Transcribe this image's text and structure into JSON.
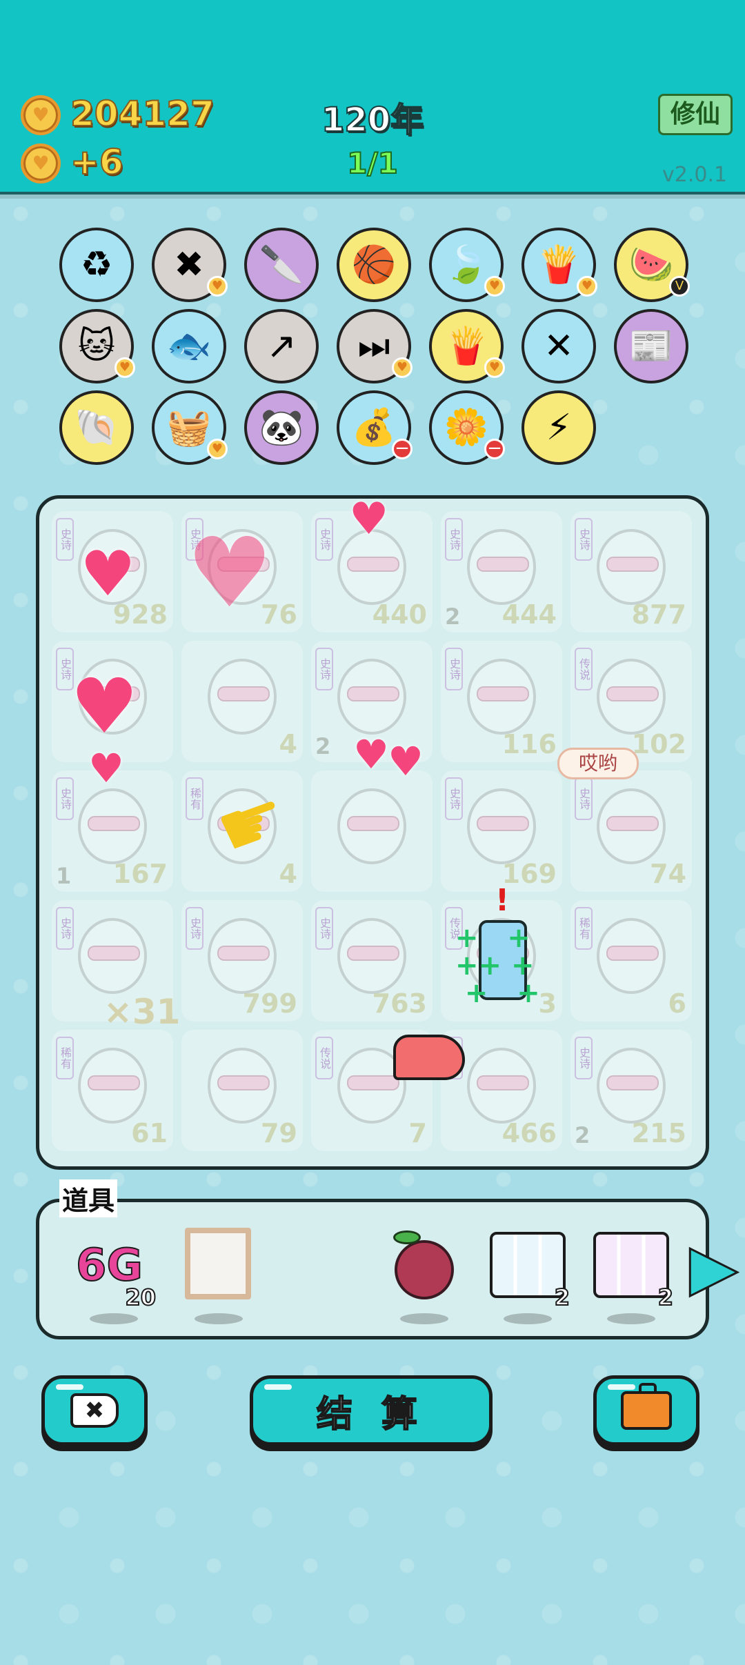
{
  "header": {
    "coins": "204127",
    "income": "+6",
    "year": "120年",
    "progress": "1/1",
    "mode_button": "修仙",
    "version": "v2.0.1"
  },
  "skills": [
    {
      "icon": "trash-recycle-icon",
      "bg": "#a8e3f4",
      "glyph": "♻",
      "badge": ""
    },
    {
      "icon": "delete-tag-icon",
      "bg": "#d8d3ce",
      "glyph": "✖",
      "badge": "heart"
    },
    {
      "icon": "cleaver-icon",
      "bg": "#c9a3df",
      "glyph": "🔪",
      "badge": ""
    },
    {
      "icon": "basketballs-icon",
      "bg": "#f7ea7a",
      "glyph": "🏀",
      "badge": ""
    },
    {
      "icon": "leaf-icon",
      "bg": "#a8e3f4",
      "glyph": "🍃",
      "badge": "heart"
    },
    {
      "icon": "fries-icon",
      "bg": "#a8e3f4",
      "glyph": "🍟",
      "badge": "heart"
    },
    {
      "icon": "fruit-bowl-icon",
      "bg": "#f7ea7a",
      "glyph": "🍉",
      "badge": "v"
    },
    {
      "icon": "cat-sunglasses-icon",
      "bg": "#d8d3ce",
      "glyph": "🐱",
      "badge": "heart"
    },
    {
      "icon": "fish-bowl-icon",
      "bg": "#a8e3f4",
      "glyph": "🐟",
      "badge": ""
    },
    {
      "icon": "arrow-up-right-icon",
      "bg": "#d8d3ce",
      "glyph": "↗",
      "badge": ""
    },
    {
      "icon": "skip-icon",
      "bg": "#d8d3ce",
      "glyph": "⏭",
      "badge": "heart"
    },
    {
      "icon": "fries-icon",
      "bg": "#f7ea7a",
      "glyph": "🍟",
      "badge": "heart"
    },
    {
      "icon": "sticks-icon",
      "bg": "#a8e3f4",
      "glyph": "✕",
      "badge": ""
    },
    {
      "icon": "time-magazine-icon",
      "bg": "#c9a3df",
      "glyph": "📰",
      "badge": ""
    },
    {
      "icon": "shell-icon",
      "bg": "#f7ea7a",
      "glyph": "🐚",
      "badge": ""
    },
    {
      "icon": "fruit-basket-icon",
      "bg": "#a8e3f4",
      "glyph": "🧺",
      "badge": "heart"
    },
    {
      "icon": "panda-icon",
      "bg": "#c9a3df",
      "glyph": "🐼",
      "badge": ""
    },
    {
      "icon": "money-bag-icon",
      "bg": "#a8e3f4",
      "glyph": "💰",
      "badge": "minus"
    },
    {
      "icon": "flower-pot-icon",
      "bg": "#a8e3f4",
      "glyph": "🌼",
      "badge": "minus"
    },
    {
      "icon": "lightning-icon",
      "bg": "#f7ea7a",
      "glyph": "⚡",
      "badge": ""
    }
  ],
  "board": {
    "bubble": "哎哟",
    "multiplier": "×31",
    "cells": [
      {
        "num": "928",
        "lnum": "",
        "tag": "史诗"
      },
      {
        "num": "76",
        "lnum": "",
        "tag": "史诗"
      },
      {
        "num": "440",
        "lnum": "",
        "tag": "史诗"
      },
      {
        "num": "444",
        "lnum": "2",
        "tag": "史诗"
      },
      {
        "num": "877",
        "lnum": "",
        "tag": "史诗"
      },
      {
        "num": "×31",
        "lnum": "",
        "tag": "史诗"
      },
      {
        "num": "4",
        "lnum": "",
        "tag": ""
      },
      {
        "num": "",
        "lnum": "2",
        "tag": "史诗"
      },
      {
        "num": "116",
        "lnum": "",
        "tag": "史诗"
      },
      {
        "num": "102",
        "lnum": "",
        "tag": "传说"
      },
      {
        "num": "167",
        "lnum": "1",
        "tag": "史诗"
      },
      {
        "num": "4",
        "lnum": "",
        "tag": "稀有"
      },
      {
        "num": "",
        "lnum": "",
        "tag": ""
      },
      {
        "num": "169",
        "lnum": "",
        "tag": "史诗"
      },
      {
        "num": "74",
        "lnum": "",
        "tag": "史诗"
      },
      {
        "num": "",
        "lnum": "",
        "tag": "史诗"
      },
      {
        "num": "799",
        "lnum": "",
        "tag": "史诗"
      },
      {
        "num": "763",
        "lnum": "",
        "tag": "史诗"
      },
      {
        "num": "3",
        "lnum": "",
        "tag": "传说"
      },
      {
        "num": "6",
        "lnum": "",
        "tag": "稀有"
      },
      {
        "num": "61",
        "lnum": "",
        "tag": "稀有"
      },
      {
        "num": "79",
        "lnum": "",
        "tag": ""
      },
      {
        "num": "7",
        "lnum": "",
        "tag": "传说"
      },
      {
        "num": "466",
        "lnum": "",
        "tag": "史诗"
      },
      {
        "num": "215",
        "lnum": "2",
        "tag": "史诗"
      }
    ]
  },
  "props": {
    "title": "道具",
    "items": [
      {
        "name": "6g-card",
        "label": "6G",
        "count": "20"
      },
      {
        "name": "photo-frame",
        "label": "",
        "count": ""
      },
      {
        "name": "lychee",
        "label": "",
        "count": ""
      },
      {
        "name": "rare-slot-card",
        "label": "",
        "count": "2"
      },
      {
        "name": "epic-slot-card",
        "label": "",
        "count": "2"
      }
    ]
  },
  "buttons": {
    "settle": "结 算"
  }
}
